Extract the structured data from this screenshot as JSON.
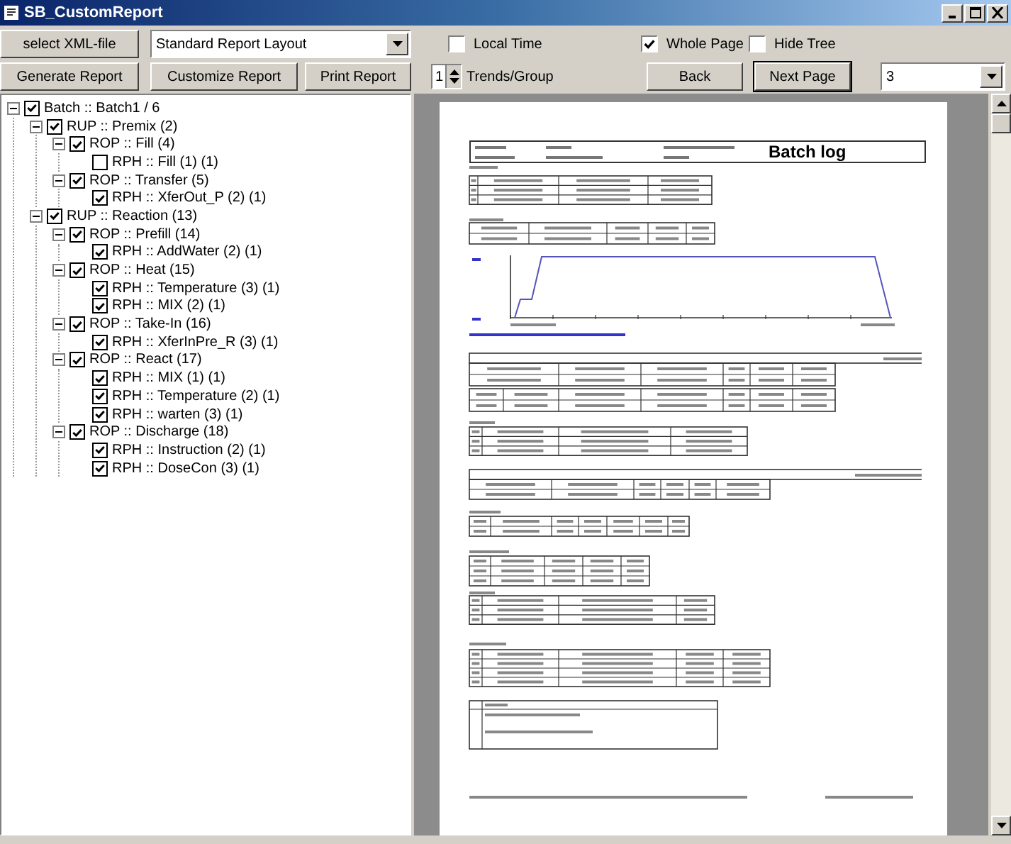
{
  "window": {
    "title": "SB_CustomReport"
  },
  "toolbar": {
    "select_xml_button": "select XML-file",
    "layout_select": {
      "value": "Standard Report Layout"
    },
    "generate_button": "Generate Report",
    "customize_button": "Customize Report",
    "print_button": "Print Report",
    "local_time": {
      "label": "Local Time",
      "checked": false
    },
    "trends_per_group": {
      "value": "1",
      "label": "Trends/Group"
    },
    "whole_page": {
      "label": "Whole Page",
      "checked": true
    },
    "hide_tree": {
      "label": "Hide Tree",
      "checked": false
    },
    "back_button": "Back",
    "next_page_button": "Next Page",
    "page_select": {
      "value": "3"
    }
  },
  "tree": [
    {
      "label": "Batch :: Batch1 / 6",
      "checked": true,
      "expanded": true,
      "children": [
        {
          "label": "RUP :: Premix (2)",
          "checked": true,
          "expanded": true,
          "children": [
            {
              "label": "ROP :: Fill (4)",
              "checked": true,
              "expanded": true,
              "children": [
                {
                  "label": "RPH :: Fill (1) (1)",
                  "checked": false
                }
              ]
            },
            {
              "label": "ROP :: Transfer (5)",
              "checked": true,
              "expanded": true,
              "children": [
                {
                  "label": "RPH :: XferOut_P (2) (1)",
                  "checked": true
                }
              ]
            }
          ]
        },
        {
          "label": "RUP :: Reaction (13)",
          "checked": true,
          "expanded": true,
          "children": [
            {
              "label": "ROP :: Prefill (14)",
              "checked": true,
              "expanded": true,
              "children": [
                {
                  "label": "RPH :: AddWater (2) (1)",
                  "checked": true
                }
              ]
            },
            {
              "label": "ROP :: Heat (15)",
              "checked": true,
              "expanded": true,
              "children": [
                {
                  "label": "RPH :: Temperature (3) (1)",
                  "checked": true
                },
                {
                  "label": "RPH :: MIX (2) (1)",
                  "checked": true
                }
              ]
            },
            {
              "label": "ROP :: Take-In (16)",
              "checked": true,
              "expanded": true,
              "children": [
                {
                  "label": "RPH :: XferInPre_R (3) (1)",
                  "checked": true
                }
              ]
            },
            {
              "label": "ROP :: React (17)",
              "checked": true,
              "expanded": true,
              "children": [
                {
                  "label": "RPH :: MIX (1) (1)",
                  "checked": true
                },
                {
                  "label": "RPH :: Temperature (2) (1)",
                  "checked": true
                },
                {
                  "label": "RPH ::  warten  (3) (1)",
                  "checked": true
                }
              ]
            },
            {
              "label": "ROP :: Discharge (18)",
              "checked": true,
              "expanded": true,
              "children": [
                {
                  "label": "RPH :: Instruction (2) (1)",
                  "checked": true
                },
                {
                  "label": "RPH :: DoseCon (3) (1)",
                  "checked": true
                }
              ]
            }
          ]
        }
      ]
    }
  ],
  "report": {
    "title": "Batch log"
  }
}
